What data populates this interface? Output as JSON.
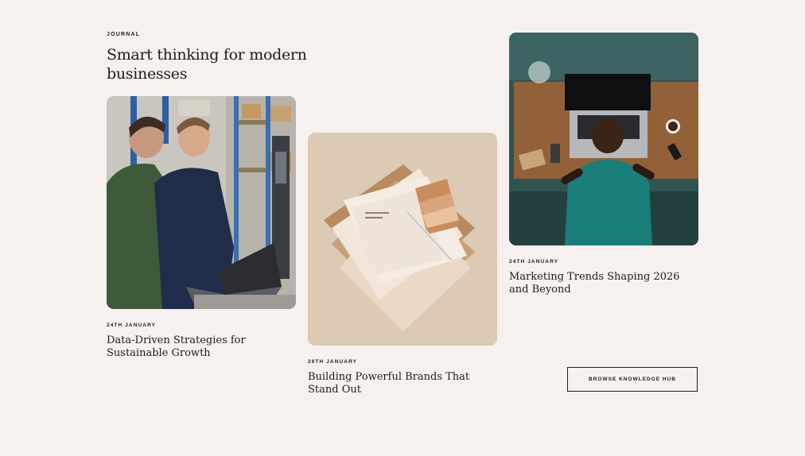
{
  "section": {
    "eyebrow": "JOURNAL",
    "headline": "Smart thinking for modern businesses"
  },
  "articles": [
    {
      "date": "24TH JANUARY",
      "title": "Data-Driven Strategies for Sustainable Growth",
      "image_icon": "photo-two-men-with-laptop"
    },
    {
      "date": "26TH JANUARY",
      "title": "Building Powerful Brands That Stand Out",
      "image_icon": "photo-brand-stationery"
    },
    {
      "date": "24TH JANUARY",
      "title": "Marketing Trends Shaping 2026 and Beyond",
      "image_icon": "photo-person-at-laptop-desk"
    }
  ],
  "cta": {
    "label": "BROWSE KNOWLEDGE HUB"
  },
  "colors": {
    "background": "#f6f1ef",
    "text": "#1f1c1a"
  }
}
